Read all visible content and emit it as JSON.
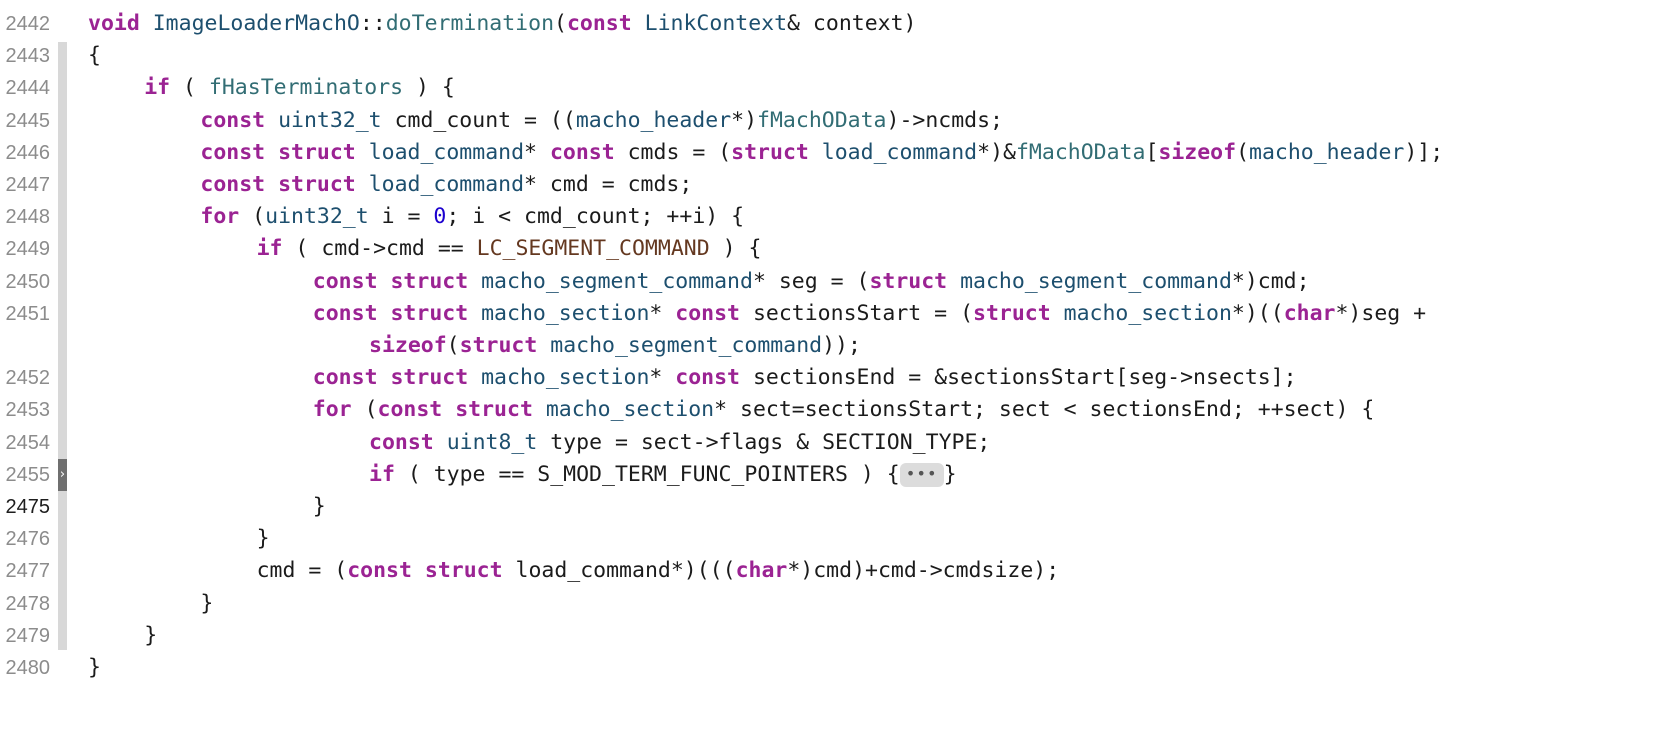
{
  "editor": {
    "lines": [
      {
        "number": "2442",
        "indent": 0,
        "current": false,
        "tokens": [
          {
            "t": "void",
            "c": "kw"
          },
          {
            "t": " ",
            "c": "plain"
          },
          {
            "t": "ImageLoaderMachO",
            "c": "ty"
          },
          {
            "t": "::",
            "c": "plain"
          },
          {
            "t": "doTermination",
            "c": "fn"
          },
          {
            "t": "(",
            "c": "plain"
          },
          {
            "t": "const",
            "c": "kw"
          },
          {
            "t": " ",
            "c": "plain"
          },
          {
            "t": "LinkContext",
            "c": "ty"
          },
          {
            "t": "& context)",
            "c": "plain"
          }
        ]
      },
      {
        "number": "2443",
        "indent": 0,
        "current": false,
        "tokens": [
          {
            "t": "{",
            "c": "plain"
          }
        ]
      },
      {
        "number": "2444",
        "indent": 1,
        "current": false,
        "tokens": [
          {
            "t": "if",
            "c": "kw"
          },
          {
            "t": " ( ",
            "c": "plain"
          },
          {
            "t": "fHasTerminators",
            "c": "fn"
          },
          {
            "t": " ) {",
            "c": "plain"
          }
        ]
      },
      {
        "number": "2445",
        "indent": 2,
        "current": false,
        "tokens": [
          {
            "t": "const",
            "c": "kw"
          },
          {
            "t": " ",
            "c": "plain"
          },
          {
            "t": "uint32_t",
            "c": "ty"
          },
          {
            "t": " cmd_count = ((",
            "c": "plain"
          },
          {
            "t": "macho_header",
            "c": "ty"
          },
          {
            "t": "*)",
            "c": "plain"
          },
          {
            "t": "fMachOData",
            "c": "fn"
          },
          {
            "t": ")->ncmds;",
            "c": "plain"
          }
        ]
      },
      {
        "number": "2446",
        "indent": 2,
        "current": false,
        "tokens": [
          {
            "t": "const",
            "c": "kw"
          },
          {
            "t": " ",
            "c": "plain"
          },
          {
            "t": "struct",
            "c": "kw"
          },
          {
            "t": " ",
            "c": "plain"
          },
          {
            "t": "load_command",
            "c": "ty"
          },
          {
            "t": "* ",
            "c": "plain"
          },
          {
            "t": "const",
            "c": "kw"
          },
          {
            "t": " cmds = (",
            "c": "plain"
          },
          {
            "t": "struct",
            "c": "kw"
          },
          {
            "t": " ",
            "c": "plain"
          },
          {
            "t": "load_command",
            "c": "ty"
          },
          {
            "t": "*)&",
            "c": "plain"
          },
          {
            "t": "fMachOData",
            "c": "fn"
          },
          {
            "t": "[",
            "c": "plain"
          },
          {
            "t": "sizeof",
            "c": "kw"
          },
          {
            "t": "(",
            "c": "plain"
          },
          {
            "t": "macho_header",
            "c": "ty"
          },
          {
            "t": ")];",
            "c": "plain"
          }
        ]
      },
      {
        "number": "2447",
        "indent": 2,
        "current": false,
        "tokens": [
          {
            "t": "const",
            "c": "kw"
          },
          {
            "t": " ",
            "c": "plain"
          },
          {
            "t": "struct",
            "c": "kw"
          },
          {
            "t": " ",
            "c": "plain"
          },
          {
            "t": "load_command",
            "c": "ty"
          },
          {
            "t": "* cmd = cmds;",
            "c": "plain"
          }
        ]
      },
      {
        "number": "2448",
        "indent": 2,
        "current": false,
        "tokens": [
          {
            "t": "for",
            "c": "kw"
          },
          {
            "t": " (",
            "c": "plain"
          },
          {
            "t": "uint32_t",
            "c": "ty"
          },
          {
            "t": " i = ",
            "c": "plain"
          },
          {
            "t": "0",
            "c": "num"
          },
          {
            "t": "; i < cmd_count; ++i) {",
            "c": "plain"
          }
        ]
      },
      {
        "number": "2449",
        "indent": 3,
        "current": false,
        "tokens": [
          {
            "t": "if",
            "c": "kw"
          },
          {
            "t": " ( cmd->cmd == ",
            "c": "plain"
          },
          {
            "t": "LC_SEGMENT_COMMAND",
            "c": "mac"
          },
          {
            "t": " ) {",
            "c": "plain"
          }
        ]
      },
      {
        "number": "2450",
        "indent": 4,
        "current": false,
        "tokens": [
          {
            "t": "const",
            "c": "kw"
          },
          {
            "t": " ",
            "c": "plain"
          },
          {
            "t": "struct",
            "c": "kw"
          },
          {
            "t": " ",
            "c": "plain"
          },
          {
            "t": "macho_segment_command",
            "c": "ty"
          },
          {
            "t": "* seg = (",
            "c": "plain"
          },
          {
            "t": "struct",
            "c": "kw"
          },
          {
            "t": " ",
            "c": "plain"
          },
          {
            "t": "macho_segment_command",
            "c": "ty"
          },
          {
            "t": "*)cmd;",
            "c": "plain"
          }
        ]
      },
      {
        "number": "2451",
        "indent": 4,
        "current": false,
        "tokens": [
          {
            "t": "const",
            "c": "kw"
          },
          {
            "t": " ",
            "c": "plain"
          },
          {
            "t": "struct",
            "c": "kw"
          },
          {
            "t": " ",
            "c": "plain"
          },
          {
            "t": "macho_section",
            "c": "ty"
          },
          {
            "t": "* ",
            "c": "plain"
          },
          {
            "t": "const",
            "c": "kw"
          },
          {
            "t": " sectionsStart = (",
            "c": "plain"
          },
          {
            "t": "struct",
            "c": "kw"
          },
          {
            "t": " ",
            "c": "plain"
          },
          {
            "t": "macho_section",
            "c": "ty"
          },
          {
            "t": "*)((",
            "c": "plain"
          },
          {
            "t": "char",
            "c": "kw"
          },
          {
            "t": "*)seg +",
            "c": "plain"
          }
        ]
      },
      {
        "number": "",
        "indent": 5,
        "current": false,
        "tokens": [
          {
            "t": "sizeof",
            "c": "kw"
          },
          {
            "t": "(",
            "c": "plain"
          },
          {
            "t": "struct",
            "c": "kw"
          },
          {
            "t": " ",
            "c": "plain"
          },
          {
            "t": "macho_segment_command",
            "c": "ty"
          },
          {
            "t": "));",
            "c": "plain"
          }
        ]
      },
      {
        "number": "2452",
        "indent": 4,
        "current": false,
        "tokens": [
          {
            "t": "const",
            "c": "kw"
          },
          {
            "t": " ",
            "c": "plain"
          },
          {
            "t": "struct",
            "c": "kw"
          },
          {
            "t": " ",
            "c": "plain"
          },
          {
            "t": "macho_section",
            "c": "ty"
          },
          {
            "t": "* ",
            "c": "plain"
          },
          {
            "t": "const",
            "c": "kw"
          },
          {
            "t": " sectionsEnd = &sectionsStart[seg->nsects];",
            "c": "plain"
          }
        ]
      },
      {
        "number": "2453",
        "indent": 4,
        "current": false,
        "tokens": [
          {
            "t": "for",
            "c": "kw"
          },
          {
            "t": " (",
            "c": "plain"
          },
          {
            "t": "const",
            "c": "kw"
          },
          {
            "t": " ",
            "c": "plain"
          },
          {
            "t": "struct",
            "c": "kw"
          },
          {
            "t": " ",
            "c": "plain"
          },
          {
            "t": "macho_section",
            "c": "ty"
          },
          {
            "t": "* sect=sectionsStart; sect < sectionsEnd; ++sect) {",
            "c": "plain"
          }
        ]
      },
      {
        "number": "2454",
        "indent": 5,
        "current": false,
        "tokens": [
          {
            "t": "const",
            "c": "kw"
          },
          {
            "t": " ",
            "c": "plain"
          },
          {
            "t": "uint8_t",
            "c": "ty"
          },
          {
            "t": " type = sect->flags & SECTION_TYPE;",
            "c": "plain"
          }
        ]
      },
      {
        "number": "2455",
        "indent": 5,
        "current": false,
        "folded": true,
        "tokens": [
          {
            "t": "if",
            "c": "kw"
          },
          {
            "t": " ( type == S_MOD_TERM_FUNC_POINTERS ) {",
            "c": "plain"
          },
          {
            "t": "•••",
            "c": "ellipsis"
          },
          {
            "t": "}",
            "c": "plain"
          }
        ]
      },
      {
        "number": "2475",
        "indent": 4,
        "current": true,
        "tokens": [
          {
            "t": "}",
            "c": "plain"
          }
        ]
      },
      {
        "number": "2476",
        "indent": 3,
        "current": false,
        "tokens": [
          {
            "t": "}",
            "c": "plain"
          }
        ]
      },
      {
        "number": "2477",
        "indent": 3,
        "current": false,
        "tokens": [
          {
            "t": "cmd = (",
            "c": "plain"
          },
          {
            "t": "const",
            "c": "kw"
          },
          {
            "t": " ",
            "c": "plain"
          },
          {
            "t": "struct",
            "c": "kw"
          },
          {
            "t": " load_command*)(((",
            "c": "plain"
          },
          {
            "t": "char",
            "c": "kw"
          },
          {
            "t": "*)cmd)+cmd->cmdsize);",
            "c": "plain"
          }
        ]
      },
      {
        "number": "2478",
        "indent": 2,
        "current": false,
        "tokens": [
          {
            "t": "}",
            "c": "plain"
          }
        ]
      },
      {
        "number": "2479",
        "indent": 1,
        "current": false,
        "tokens": [
          {
            "t": "}",
            "c": "plain"
          }
        ]
      },
      {
        "number": "2480",
        "indent": 0,
        "current": false,
        "tokens": [
          {
            "t": "}",
            "c": "plain"
          }
        ]
      }
    ],
    "fold_marker_glyph": "›"
  }
}
